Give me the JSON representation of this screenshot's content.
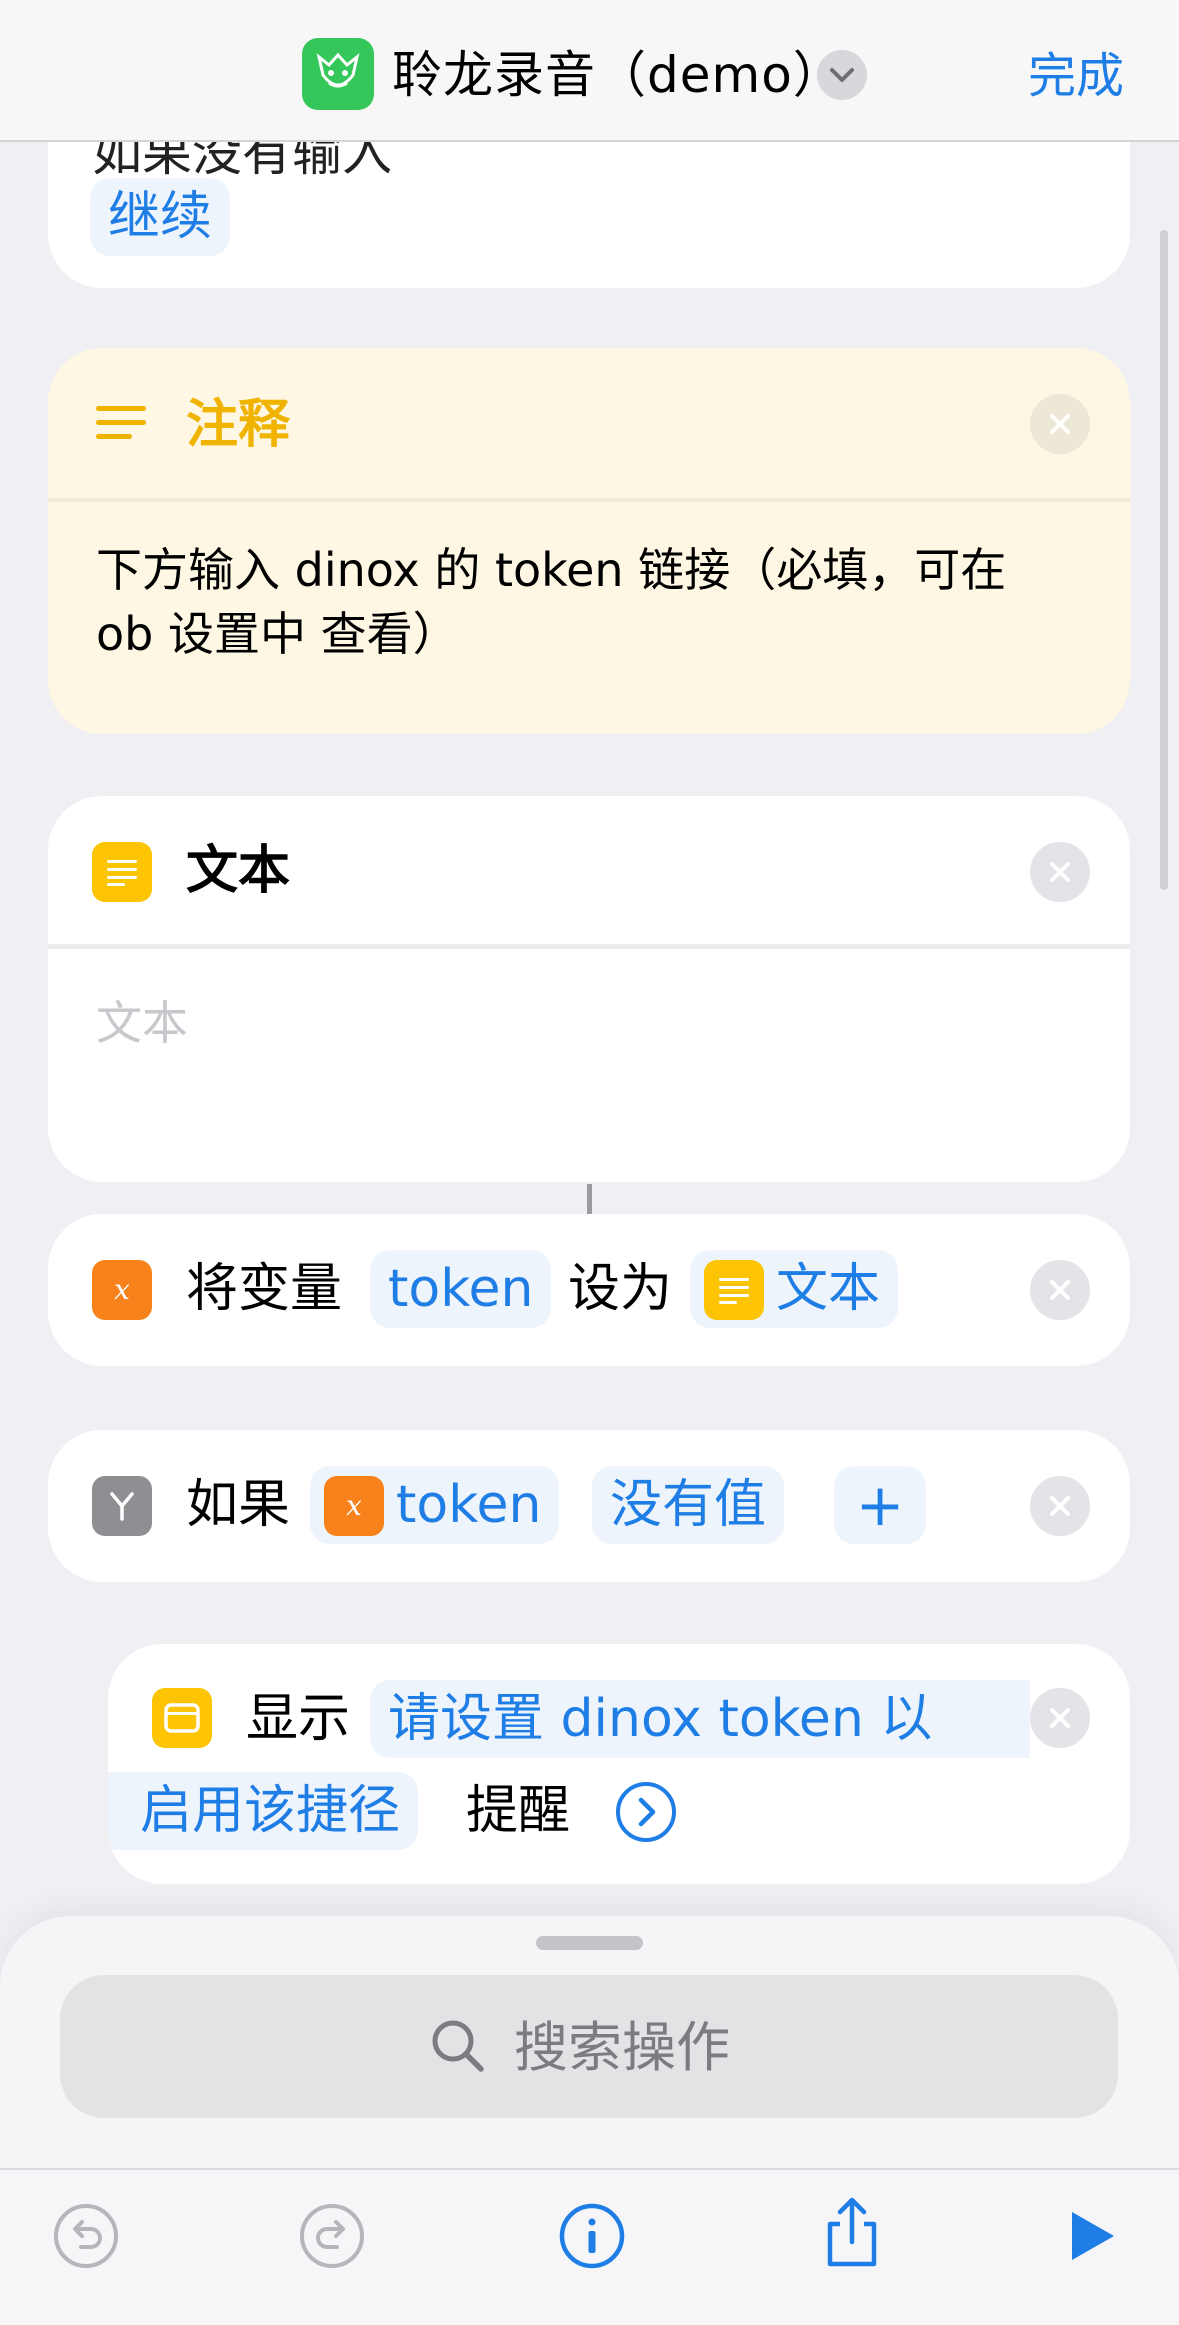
{
  "header": {
    "title": "聆龙录音（demo）",
    "done_label": "完成"
  },
  "cards": {
    "prev": {
      "partial_label": "如果没有输入",
      "chip": "继续"
    },
    "comment": {
      "title": "注释",
      "body_line1": "下方输入 dinox 的 token 链接（必填，可在",
      "body_line2": "ob 设置中 查看）"
    },
    "text": {
      "title": "文本",
      "placeholder": "文本"
    },
    "setvar": {
      "label": "将变量",
      "var_chip": "token",
      "mid": "设为",
      "value_chip": "文本"
    },
    "if": {
      "label": "如果",
      "var_chip": "token",
      "cond_chip": "没有值",
      "add": "+"
    },
    "show": {
      "label": "显示",
      "msg_line1": "请设置 dinox token 以",
      "msg_line2": "启用该捷径",
      "suffix": "提醒"
    }
  },
  "search": {
    "placeholder": "搜索操作"
  },
  "colors": {
    "accent": "#1f7ee6",
    "comment_bg": "#fdf7e3",
    "comment_title": "#f0b400",
    "var_orange": "#f7821b",
    "text_yellow": "#fcc402",
    "if_gray": "#8e8e93",
    "app_green": "#35c759"
  },
  "icons": [
    "dragon-app-icon",
    "chevron-down-icon",
    "lines-icon",
    "text-doc-icon",
    "variable-x-icon",
    "branch-icon",
    "window-icon",
    "arrow-right-circle-icon",
    "search-icon",
    "undo-icon",
    "redo-icon",
    "info-icon",
    "share-icon",
    "play-icon",
    "close-icon"
  ]
}
